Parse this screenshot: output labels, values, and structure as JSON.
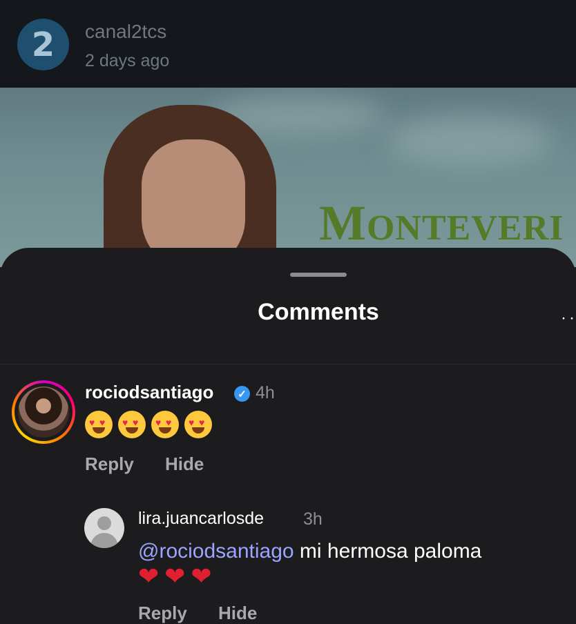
{
  "post": {
    "avatar_text": "2",
    "username": "canal2tcs",
    "time": "2 days ago",
    "show_title_first": "M",
    "show_title_rest": "ONTEVERI"
  },
  "sheet": {
    "title": "Comments",
    "more_label": "··"
  },
  "comments": [
    {
      "username": "rociodsantiago",
      "verified": true,
      "time": "4h",
      "emoji_count": 4,
      "reply_label": "Reply",
      "hide_label": "Hide"
    },
    {
      "username": "lira.juancarlosde",
      "time": "3h",
      "mention": "@rociodsantiago",
      "text": " mi hermosa paloma",
      "hearts": [
        "❤",
        "❤",
        "❤"
      ],
      "reply_label": "Reply",
      "hide_label": "Hide"
    }
  ],
  "colors": {
    "background": "#1c1c1e",
    "mention": "#9aa5ff",
    "verified": "#3897f0",
    "title_green": "#557a28"
  }
}
